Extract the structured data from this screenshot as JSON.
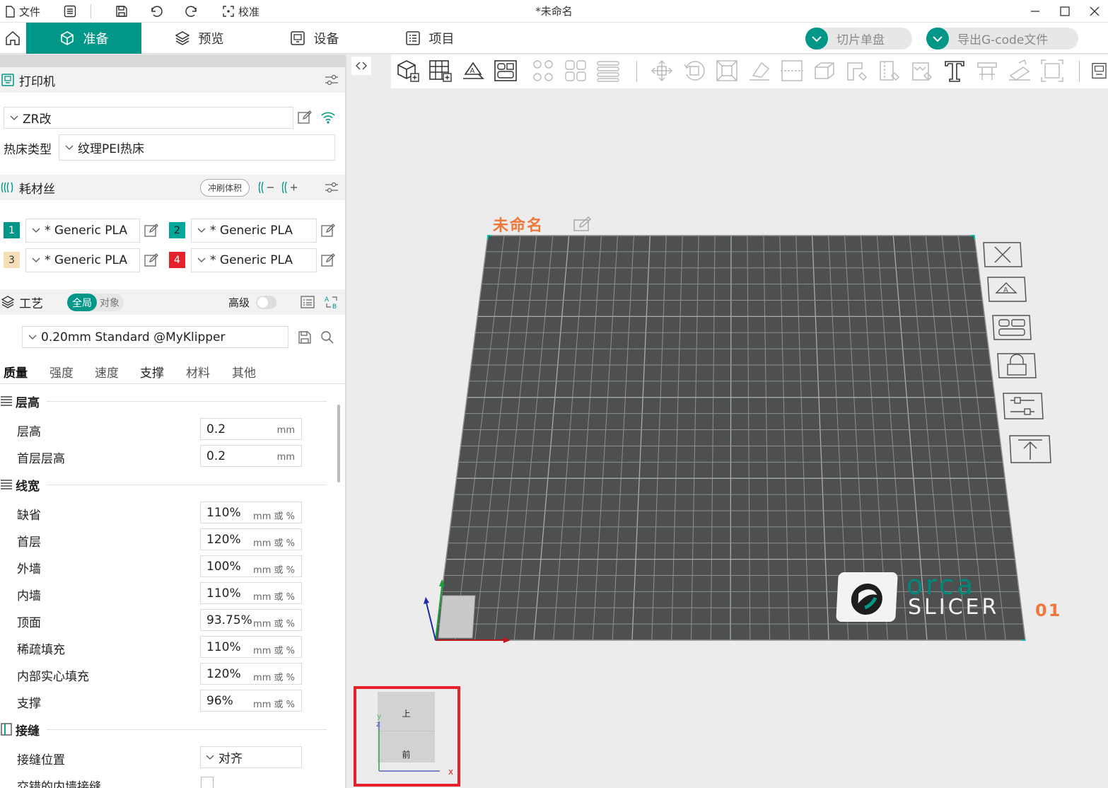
{
  "titlebar": {
    "file_label": "文件",
    "calibrate_label": "校准",
    "title": "*未命名"
  },
  "tabs": [
    {
      "label": "准备",
      "active": true
    },
    {
      "label": "预览",
      "active": false
    },
    {
      "label": "设备",
      "active": false
    },
    {
      "label": "项目",
      "active": false
    }
  ],
  "actions": {
    "slice_label": "切片单盘",
    "export_label": "导出G-code文件"
  },
  "printer": {
    "section_title": "打印机",
    "printer_name": "ZR改",
    "bed_type_label": "热床类型",
    "bed_type_value": "纹理PEI热床"
  },
  "filament": {
    "section_title": "耗材丝",
    "flush_button": "冲刷体积",
    "slots": [
      {
        "num": "1",
        "name": "* Generic PLA",
        "color": "#009688",
        "text_color": "#ffffff"
      },
      {
        "num": "2",
        "name": "* Generic PLA",
        "color": "#00a89a",
        "text_color": "#111111"
      },
      {
        "num": "3",
        "name": "* Generic PLA",
        "color": "#f6dfb7",
        "text_color": "#333333"
      },
      {
        "num": "4",
        "name": "* Generic PLA",
        "color": "#e3222b",
        "text_color": "#ffffff"
      }
    ]
  },
  "process": {
    "section_title": "工艺",
    "global_label": "全局",
    "object_label": "对象",
    "advanced_label": "高级",
    "preset": "0.20mm Standard @MyKlipper"
  },
  "subtabs": [
    "质量",
    "强度",
    "速度",
    "支撑",
    "材料",
    "其他"
  ],
  "groups": {
    "layer_height": "层高",
    "line_width": "线宽",
    "seam": "接缝"
  },
  "layer_rows": [
    {
      "label": "层高",
      "value": "0.2",
      "unit": "mm"
    },
    {
      "label": "首层层高",
      "value": "0.2",
      "unit": "mm"
    }
  ],
  "width_rows": [
    {
      "label": "缺省",
      "value": "110%",
      "unit": "mm 或 %"
    },
    {
      "label": "首层",
      "value": "120%",
      "unit": "mm 或 %"
    },
    {
      "label": "外墙",
      "value": "100%",
      "unit": "mm 或 %"
    },
    {
      "label": "内墙",
      "value": "110%",
      "unit": "mm 或 %"
    },
    {
      "label": "顶面",
      "value": "93.75%",
      "unit": "mm 或 %"
    },
    {
      "label": "稀疏填充",
      "value": "110%",
      "unit": "mm 或 %"
    },
    {
      "label": "内部实心填充",
      "value": "120%",
      "unit": "mm 或 %"
    },
    {
      "label": "支撑",
      "value": "96%",
      "unit": "mm 或 %"
    }
  ],
  "seam": {
    "position_label": "接缝位置",
    "position_value": "对齐",
    "staggered_label": "交错的内墙接缝"
  },
  "plate": {
    "name": "未命名",
    "number": "01",
    "logo_top": "orca",
    "logo_bottom": "slicer"
  },
  "viewcube": {
    "top": "上",
    "front": "前",
    "axis_x": "x",
    "axis_y": "y",
    "axis_z": "z"
  },
  "colors": {
    "accent": "#009688",
    "plate_title": "#f0773a",
    "bed": "#4d4f50",
    "highlight_box": "#e8212a"
  }
}
